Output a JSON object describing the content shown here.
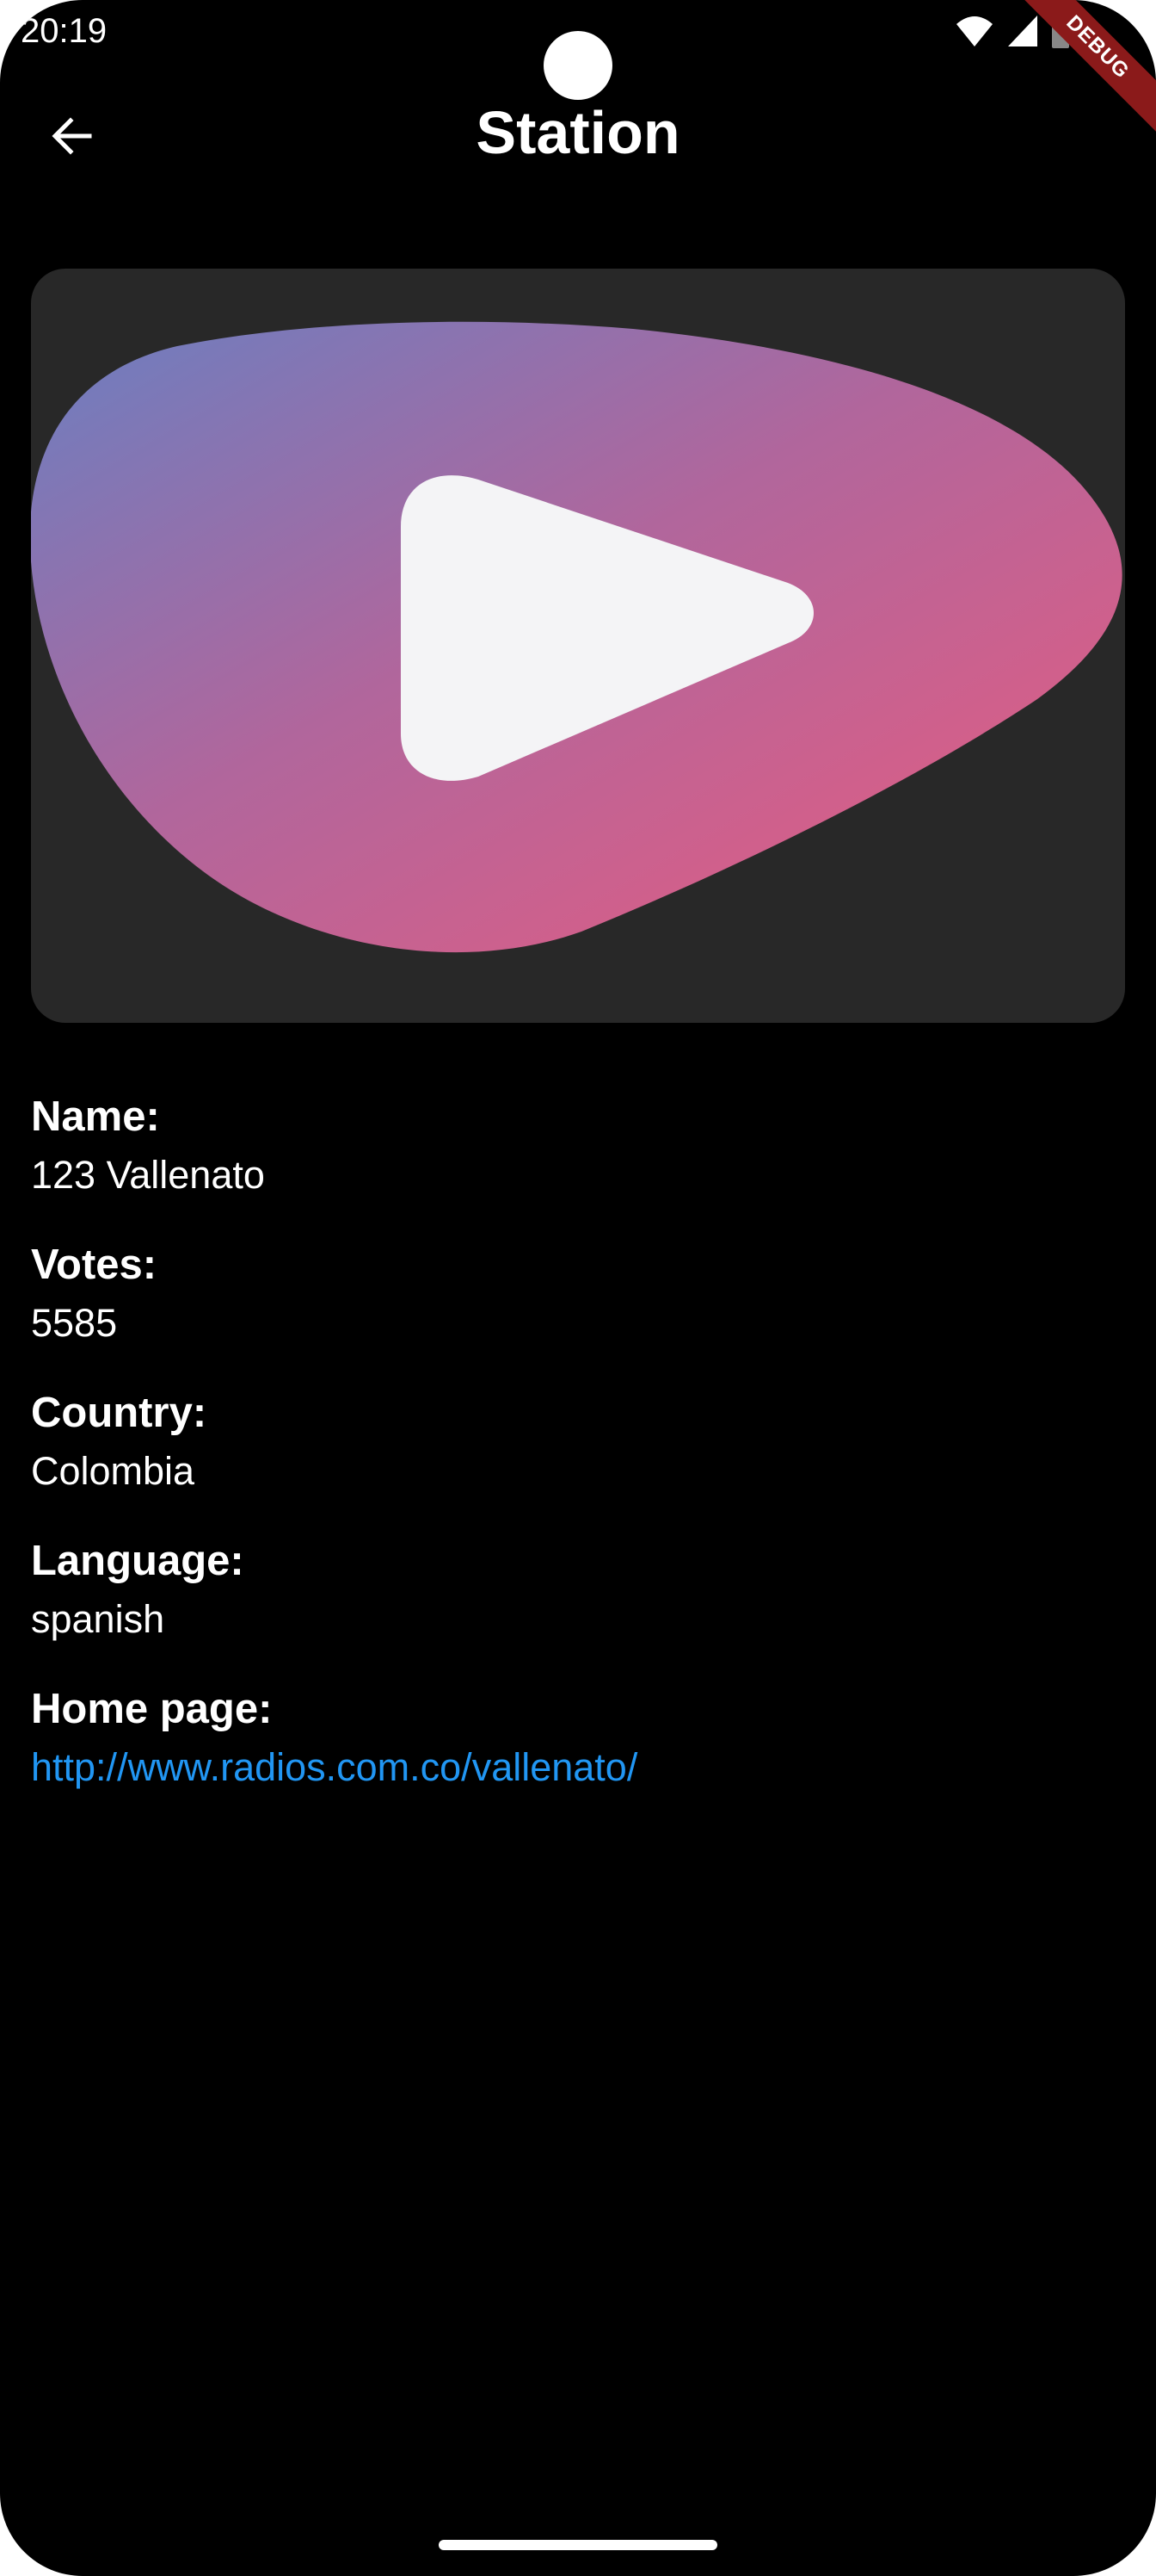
{
  "status_bar": {
    "time": "20:19",
    "debug_label": "DEBUG"
  },
  "app_bar": {
    "title": "Station",
    "back_icon": "arrow-back-icon"
  },
  "station_image": {
    "icon": "play-icon",
    "gradient_start": "#6a7fc1",
    "gradient_end": "#ea5b7e",
    "card_background": "#282828"
  },
  "details": {
    "name_label": "Name:",
    "name_value": "123 Vallenato",
    "votes_label": "Votes:",
    "votes_value": "5585",
    "country_label": "Country:",
    "country_value": "Colombia",
    "language_label": "Language:",
    "language_value": "spanish",
    "homepage_label": "Home page:",
    "homepage_value": "http://www.radios.com.co/vallenato/"
  },
  "colors": {
    "background": "#000000",
    "text": "#ffffff",
    "link": "#2196f3",
    "debug_banner": "#8b1a1a"
  }
}
